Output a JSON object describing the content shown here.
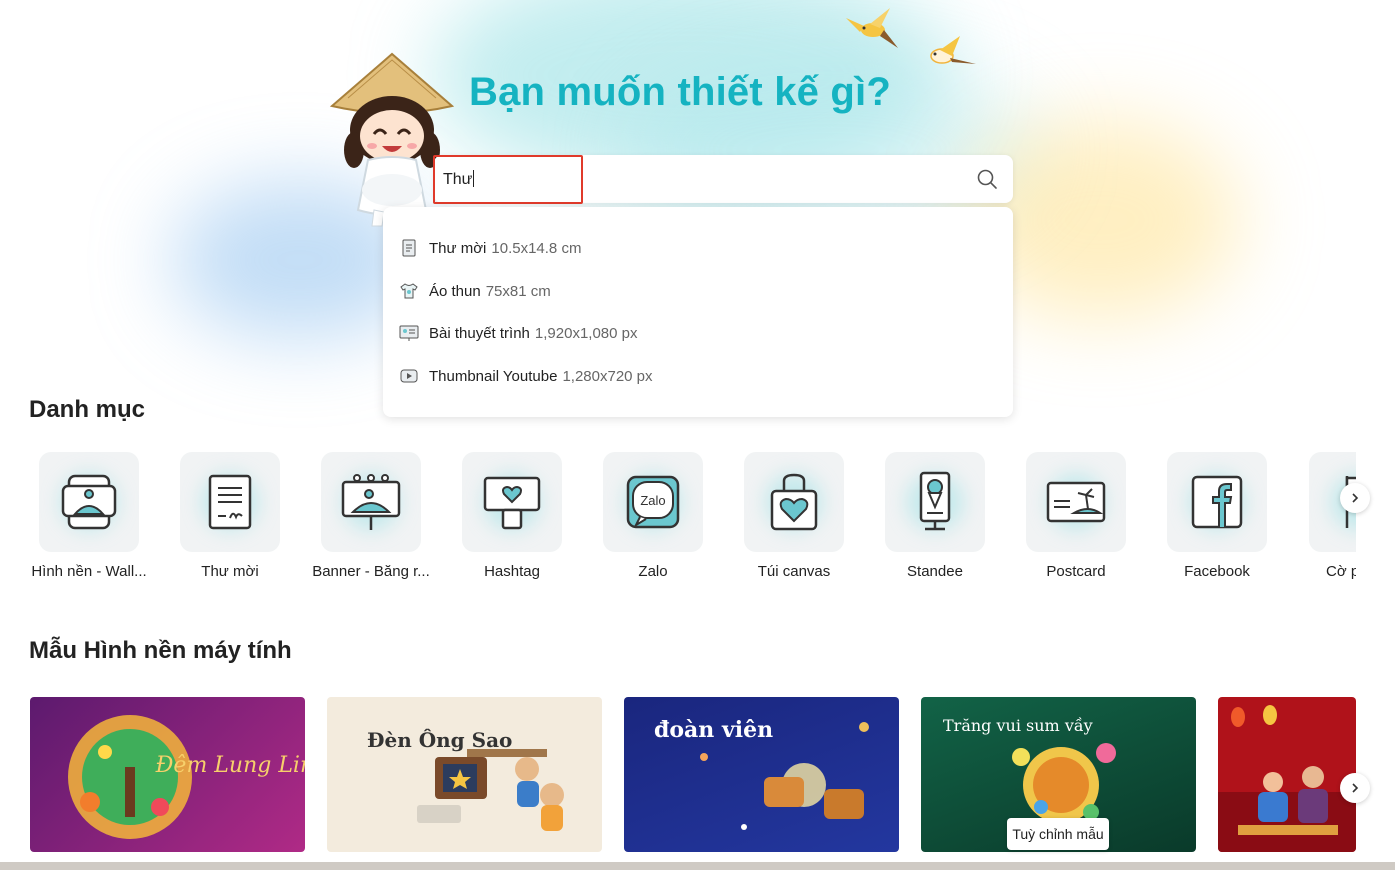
{
  "hero": {
    "title": "Bạn muốn thiết kế gì?"
  },
  "search": {
    "value": "Thư",
    "suggestions": [
      {
        "name": "Thư mời",
        "size": "10.5x14.8 cm",
        "icon": "document-icon"
      },
      {
        "name": "Áo thun",
        "size": "75x81 cm",
        "icon": "tshirt-icon"
      },
      {
        "name": "Bài thuyết trình",
        "size": "1,920x1,080 px",
        "icon": "presentation-icon"
      },
      {
        "name": "Thumbnail Youtube",
        "size": "1,280x720 px",
        "icon": "youtube-play-icon"
      }
    ]
  },
  "categories": {
    "title": "Danh mục",
    "items": [
      {
        "label": "Hình nền - Wall...",
        "icon": "phone-wallpaper-icon"
      },
      {
        "label": "Thư mời",
        "icon": "invitation-icon"
      },
      {
        "label": "Banner - Băng r...",
        "icon": "banner-icon"
      },
      {
        "label": "Hashtag",
        "icon": "hashtag-frame-icon"
      },
      {
        "label": "Zalo",
        "icon": "zalo-icon"
      },
      {
        "label": "Túi canvas",
        "icon": "tote-bag-icon"
      },
      {
        "label": "Standee",
        "icon": "standee-icon"
      },
      {
        "label": "Postcard",
        "icon": "postcard-icon"
      },
      {
        "label": "Facebook",
        "icon": "facebook-icon"
      },
      {
        "label": "Cờ p",
        "icon": "flag-icon"
      }
    ]
  },
  "templates": {
    "title": "Mẫu Hình nền máy tính",
    "customize_label": "Tuỳ chỉnh mẫu",
    "items": [
      {
        "text": "Đêm Lung Linh",
        "colors": [
          "#7a1f7c",
          "#c2338a"
        ]
      },
      {
        "text": "Đèn Ông Sao",
        "colors": [
          "#f4ece0",
          "#efe4d2"
        ]
      },
      {
        "text": "đoàn viên",
        "colors": [
          "#1b2a8c",
          "#243aa8"
        ]
      },
      {
        "text": "Trăng vui sum vầy",
        "colors": [
          "#0f5e45",
          "#0b3d2e"
        ]
      },
      {
        "text": "",
        "colors": [
          "#b8121c",
          "#8e0c14"
        ]
      }
    ]
  },
  "colors": {
    "accent": "#15b3c1",
    "highlight": "#e03a2b"
  }
}
